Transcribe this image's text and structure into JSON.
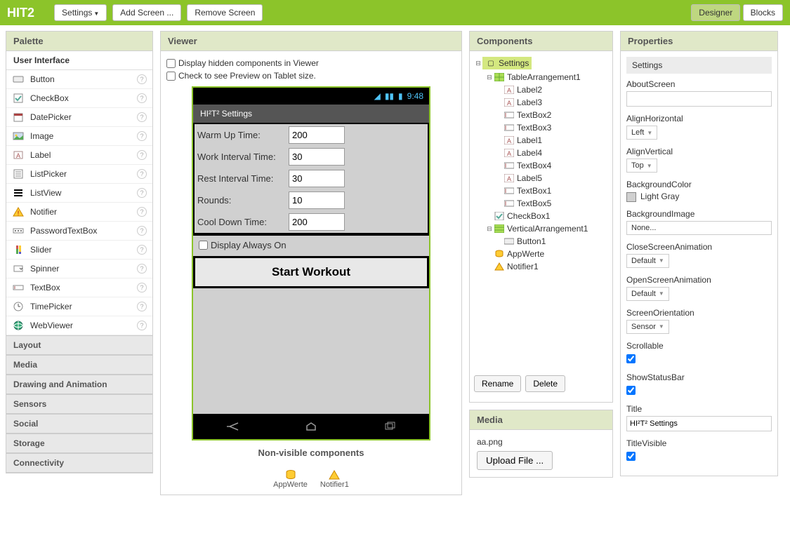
{
  "topbar": {
    "title": "HIT2",
    "settings": "Settings",
    "add_screen": "Add Screen ...",
    "remove_screen": "Remove Screen",
    "designer": "Designer",
    "blocks": "Blocks"
  },
  "palette": {
    "header": "Palette",
    "sub": "User Interface",
    "items": [
      {
        "label": "Button"
      },
      {
        "label": "CheckBox"
      },
      {
        "label": "DatePicker"
      },
      {
        "label": "Image"
      },
      {
        "label": "Label"
      },
      {
        "label": "ListPicker"
      },
      {
        "label": "ListView"
      },
      {
        "label": "Notifier"
      },
      {
        "label": "PasswordTextBox"
      },
      {
        "label": "Slider"
      },
      {
        "label": "Spinner"
      },
      {
        "label": "TextBox"
      },
      {
        "label": "TimePicker"
      },
      {
        "label": "WebViewer"
      }
    ],
    "categories": [
      "Layout",
      "Media",
      "Drawing and Animation",
      "Sensors",
      "Social",
      "Storage",
      "Connectivity"
    ]
  },
  "viewer": {
    "header": "Viewer",
    "hidden_label": "Display hidden components in Viewer",
    "tablet_label": "Check to see Preview on Tablet size.",
    "status_time": "9:48",
    "app_title": "HI²T² Settings",
    "form": {
      "warm_up": {
        "label": "Warm Up Time:",
        "value": "200"
      },
      "work": {
        "label": "Work Interval Time:",
        "value": "30"
      },
      "rest": {
        "label": "Rest Interval Time:",
        "value": "30"
      },
      "rounds": {
        "label": "Rounds:",
        "value": "10"
      },
      "cool": {
        "label": "Cool Down Time:",
        "value": "200"
      }
    },
    "display_always": "Display Always On",
    "start_workout": "Start Workout",
    "nonvis_header": "Non-visible components",
    "nonvis": {
      "appwerte": "AppWerte",
      "notifier": "Notifier1"
    }
  },
  "components": {
    "header": "Components",
    "tree": {
      "root": "Settings",
      "table": "TableArrangement1",
      "label2": "Label2",
      "label3": "Label3",
      "textbox2": "TextBox2",
      "textbox3": "TextBox3",
      "label1": "Label1",
      "label4": "Label4",
      "textbox4": "TextBox4",
      "label5": "Label5",
      "textbox1": "TextBox1",
      "textbox5": "TextBox5",
      "checkbox1": "CheckBox1",
      "vert": "VerticalArrangement1",
      "button1": "Button1",
      "appwerte": "AppWerte",
      "notifier": "Notifier1"
    },
    "rename": "Rename",
    "delete": "Delete"
  },
  "media": {
    "header": "Media",
    "file": "aa.png",
    "upload": "Upload File ..."
  },
  "properties": {
    "header": "Properties",
    "sub": "Settings",
    "about": {
      "label": "AboutScreen",
      "value": ""
    },
    "alignh": {
      "label": "AlignHorizontal",
      "value": "Left"
    },
    "alignv": {
      "label": "AlignVertical",
      "value": "Top"
    },
    "bgcolor": {
      "label": "BackgroundColor",
      "value": "Light Gray"
    },
    "bgimg": {
      "label": "BackgroundImage",
      "value": "None..."
    },
    "closeanim": {
      "label": "CloseScreenAnimation",
      "value": "Default"
    },
    "openanim": {
      "label": "OpenScreenAnimation",
      "value": "Default"
    },
    "orient": {
      "label": "ScreenOrientation",
      "value": "Sensor"
    },
    "scrollable": {
      "label": "Scrollable"
    },
    "statusbar": {
      "label": "ShowStatusBar"
    },
    "title": {
      "label": "Title",
      "value": "HI²T² Settings"
    },
    "titlevis": {
      "label": "TitleVisible"
    }
  }
}
